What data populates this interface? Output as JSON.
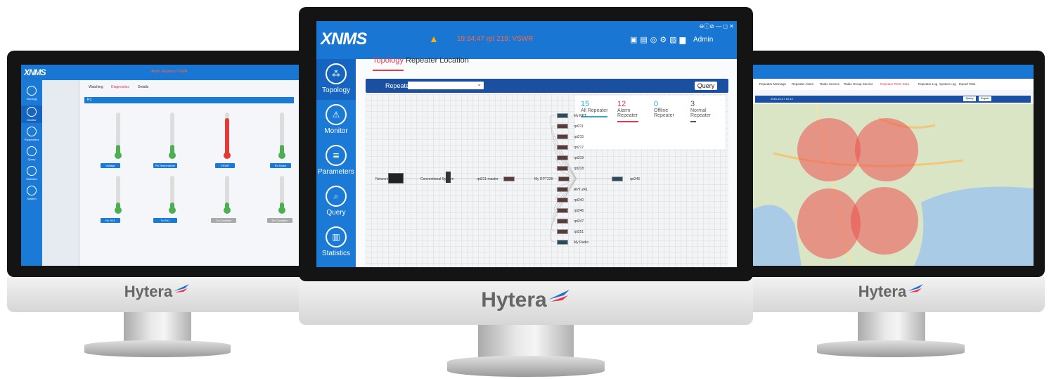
{
  "left_screen": {
    "app_logo": "XNMS",
    "alarm_text": "Alarm Repeater VSWR",
    "tabs": [
      "Watching",
      "Diagnostics",
      "Details"
    ],
    "nav_items": [
      "Topology",
      "Monitor",
      "Parameters",
      "Query",
      "Statistics",
      "System"
    ],
    "section_label": "R1",
    "gauge_labels": [
      "Voltage",
      "PA Temperature",
      "VSWR",
      "Rx Noise",
      "Rx RX1",
      "Tx RX1",
      "Tx Condition",
      "Rx Condition"
    ],
    "brand": "Hytera"
  },
  "center_screen": {
    "app_logo": "XNMS",
    "alarm_text": "19:34:47 rpt 219: VSWR",
    "user": "Admin",
    "window_controls": "⊖ⓘ⊘ — ◻ ✕",
    "nav_items": [
      {
        "label": "Topology",
        "icon": "topology-icon"
      },
      {
        "label": "Monitor",
        "icon": "warning-icon"
      },
      {
        "label": "Parameters",
        "icon": "parameters-icon"
      },
      {
        "label": "Query",
        "icon": "search-icon"
      },
      {
        "label": "Statistics",
        "icon": "statistics-icon"
      }
    ],
    "tabs": {
      "topology": "Topology",
      "location": "Repeater Location"
    },
    "query": {
      "label": "Repeater:",
      "button": "Query"
    },
    "stats": [
      {
        "num": "15",
        "label": "All Repeater",
        "color": "#29a6e3"
      },
      {
        "num": "12",
        "label": "Alarm Repeater",
        "color": "#e8384d"
      },
      {
        "num": "0",
        "label": "Offline Repeater",
        "color": "#29a6e3"
      },
      {
        "num": "3",
        "label": "Normal Repeater",
        "color": "#555555"
      }
    ],
    "topology": {
      "left_nodes": [
        "Network",
        "Conventional System",
        "rpt211-master",
        "My RPT220"
      ],
      "right_nodes": [
        "My RPT",
        "rpt211",
        "rpt215",
        "rpt217",
        "rpt219",
        "rpt218",
        "RPT-241",
        "rpt240",
        "rpt246",
        "rpt247",
        "rpt251",
        "My Radio"
      ],
      "far_node": "rpt246"
    },
    "brand": "Hytera"
  },
  "right_screen": {
    "tabs": [
      "Repeater Message",
      "Repeater Alarm",
      "Radio Service",
      "Radio Group Service",
      "Repeater RSSI Data",
      "Repeater Log",
      "System Log",
      "Export Task"
    ],
    "date_value": "2016-10-27 10:13",
    "buttons": [
      "Query",
      "Export"
    ],
    "brand": "Hytera"
  }
}
